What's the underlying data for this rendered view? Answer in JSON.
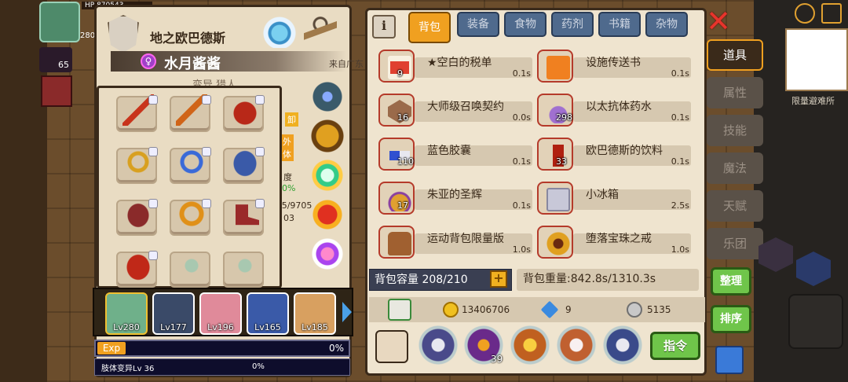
{
  "hud": {
    "hp_label": "HP",
    "hp_value": "870543",
    "level_small": "65",
    "side_num": "280"
  },
  "char": {
    "title": "地之欧巴德斯",
    "name": "水月酱酱",
    "gender_icon": "♀",
    "origin": "来自广东",
    "subtitle": "变异 猎人",
    "side_labels": [
      "卸",
      "外",
      "体",
      "度",
      "0%",
      "/5/9705",
      "03"
    ]
  },
  "equipment": {
    "slots": [
      {
        "icon": "sword-icon",
        "color": "#c8341c"
      },
      {
        "icon": "spear-icon",
        "color": "#d06418"
      },
      {
        "icon": "helmet-icon",
        "color": "#b82818"
      },
      {
        "icon": "necklace-icon",
        "color": "#d8a020"
      },
      {
        "icon": "bracelet-icon",
        "color": "#3a6ad8"
      },
      {
        "icon": "gauntlet-icon",
        "color": "#3a5aa8"
      },
      {
        "icon": "armor-icon",
        "color": "#8a2a2a"
      },
      {
        "icon": "ring-icon",
        "color": "#e09018"
      },
      {
        "icon": "boots-icon",
        "color": "#9a2a2a"
      },
      {
        "icon": "armor-red-icon",
        "color": "#c02818"
      },
      {
        "icon": "empty-slot-icon",
        "color": "#a8c8b0"
      },
      {
        "icon": "empty-slot-icon",
        "color": "#a8c8b0"
      }
    ]
  },
  "party": [
    {
      "lv": "Lv280",
      "color": "#6fb08a"
    },
    {
      "lv": "Lv177",
      "color": "#3a4a68"
    },
    {
      "lv": "Lv196",
      "color": "#e08a9a"
    },
    {
      "lv": "Lv165",
      "color": "#3a5aa8"
    },
    {
      "lv": "Lv185",
      "color": "#d8a060"
    }
  ],
  "exp": {
    "label": "Exp",
    "percent": "0%"
  },
  "mutation": {
    "label": "肢体变异Lv 36",
    "percent": "0%"
  },
  "bag": {
    "info_label": "i",
    "tabs": [
      "背包",
      "装备",
      "食物",
      "药剂",
      "书籍",
      "杂物"
    ],
    "active_tab": 0,
    "items": [
      {
        "name": "★空白的税单",
        "count": "9",
        "time": "0.1s",
        "icon": "tax-form-icon",
        "color": "#e04030"
      },
      {
        "name": "设施传送书",
        "count": "",
        "time": "0.1s",
        "icon": "teleport-book-icon",
        "color": "#f08020"
      },
      {
        "name": "大师级召唤契约",
        "count": "16",
        "time": "0.0s",
        "icon": "summon-contract-icon",
        "color": "#9a6a4a"
      },
      {
        "name": "以太抗体药水",
        "count": "298",
        "time": "0.1s",
        "icon": "ether-potion-icon",
        "color": "#a070d0"
      },
      {
        "name": "蓝色胶囊",
        "count": "110",
        "time": "0.1s",
        "icon": "blue-capsule-icon",
        "color": "#3050d0"
      },
      {
        "name": "欧巴德斯的饮料",
        "count": "33",
        "time": "0.1s",
        "icon": "drink-bottle-icon",
        "color": "#b02010"
      },
      {
        "name": "朱亚的圣辉",
        "count": "17",
        "time": "0.1s",
        "icon": "holy-flask-icon",
        "color": "#e0a030"
      },
      {
        "name": "小冰箱",
        "count": "",
        "time": "2.5s",
        "icon": "mini-fridge-icon",
        "color": "#c8c8d8"
      },
      {
        "name": "运动背包限量版",
        "count": "",
        "time": "1.0s",
        "icon": "backpack-icon",
        "color": "#a06030"
      },
      {
        "name": "堕落宝珠之戒",
        "count": "",
        "time": "1.0s",
        "icon": "orb-ring-icon",
        "color": "#e0a020"
      }
    ],
    "capacity": "背包容量 208/210",
    "weight": "背包重量:842.8s/1310.3s",
    "gold": "13406706",
    "diamond": "9",
    "silver": "5135",
    "skills_badge": "39",
    "command_label": "指令"
  },
  "rightmenu": {
    "items": [
      "道具",
      "属性",
      "技能",
      "魔法",
      "天赋",
      "乐团"
    ],
    "active": 0,
    "sort_label": "整理",
    "order_label": "排序",
    "map_label": "限量避难所"
  }
}
